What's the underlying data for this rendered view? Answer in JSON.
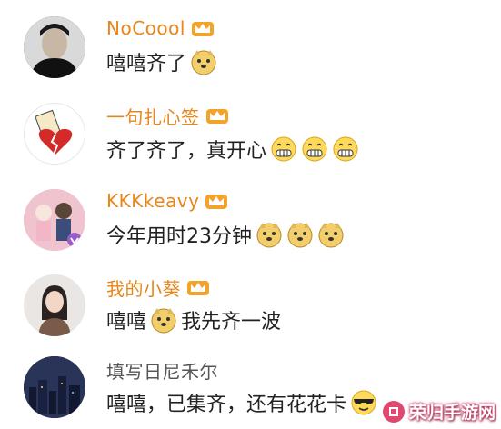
{
  "comments": [
    {
      "name": "NoCoool",
      "text": "嘻嘻齐了"
    },
    {
      "name": "一句扎心签",
      "text": "齐了齐了，真开心"
    },
    {
      "name": "KKKkeavy",
      "text": "今年用时23分钟"
    },
    {
      "name": "我的小葵",
      "text_before": "嘻嘻",
      "text_after": "我先齐一波"
    },
    {
      "name": "填写日尼禾尔",
      "text": "嘻嘻，已集齐，还有花花卡"
    }
  ],
  "colors": {
    "vip_name": "#e8861a",
    "plain_name": "#555555",
    "text": "#222222"
  },
  "icons": [
    "vip-crown-icon",
    "doge-emoji-icon",
    "grin-emoji-icon",
    "sunglasses-emoji-icon"
  ],
  "watermark": {
    "text": "荣归手游网"
  }
}
